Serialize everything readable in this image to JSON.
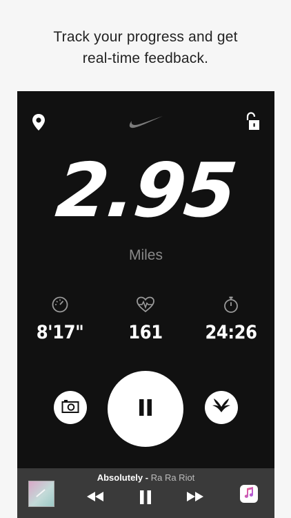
{
  "caption": {
    "line1": "Track your progress and get",
    "line2": "real-time feedback."
  },
  "run": {
    "distance": "2.95",
    "unit": "Miles",
    "pace": "8'17\"",
    "heart_rate": "161",
    "duration": "24:26"
  },
  "player": {
    "song": "Absolutely",
    "separator": " - ",
    "artist": "Ra Ra Riot"
  },
  "colors": {
    "screen_bg": "#111111",
    "player_bg": "#3a3a3a",
    "page_bg": "#f6f6f6",
    "accent": "#ffffff",
    "muted": "#8a8a8a"
  },
  "icons": {
    "location": "location-pin-icon",
    "brand": "nike-swoosh-icon",
    "lock": "unlock-icon",
    "pace": "speedometer-icon",
    "heart_rate": "heartbeat-icon",
    "duration": "stopwatch-icon",
    "camera": "camera-icon",
    "pause": "pause-icon",
    "cheer": "cheer-wings-icon",
    "previous": "previous-track-icon",
    "next": "next-track-icon",
    "music_app": "music-note-icon"
  }
}
